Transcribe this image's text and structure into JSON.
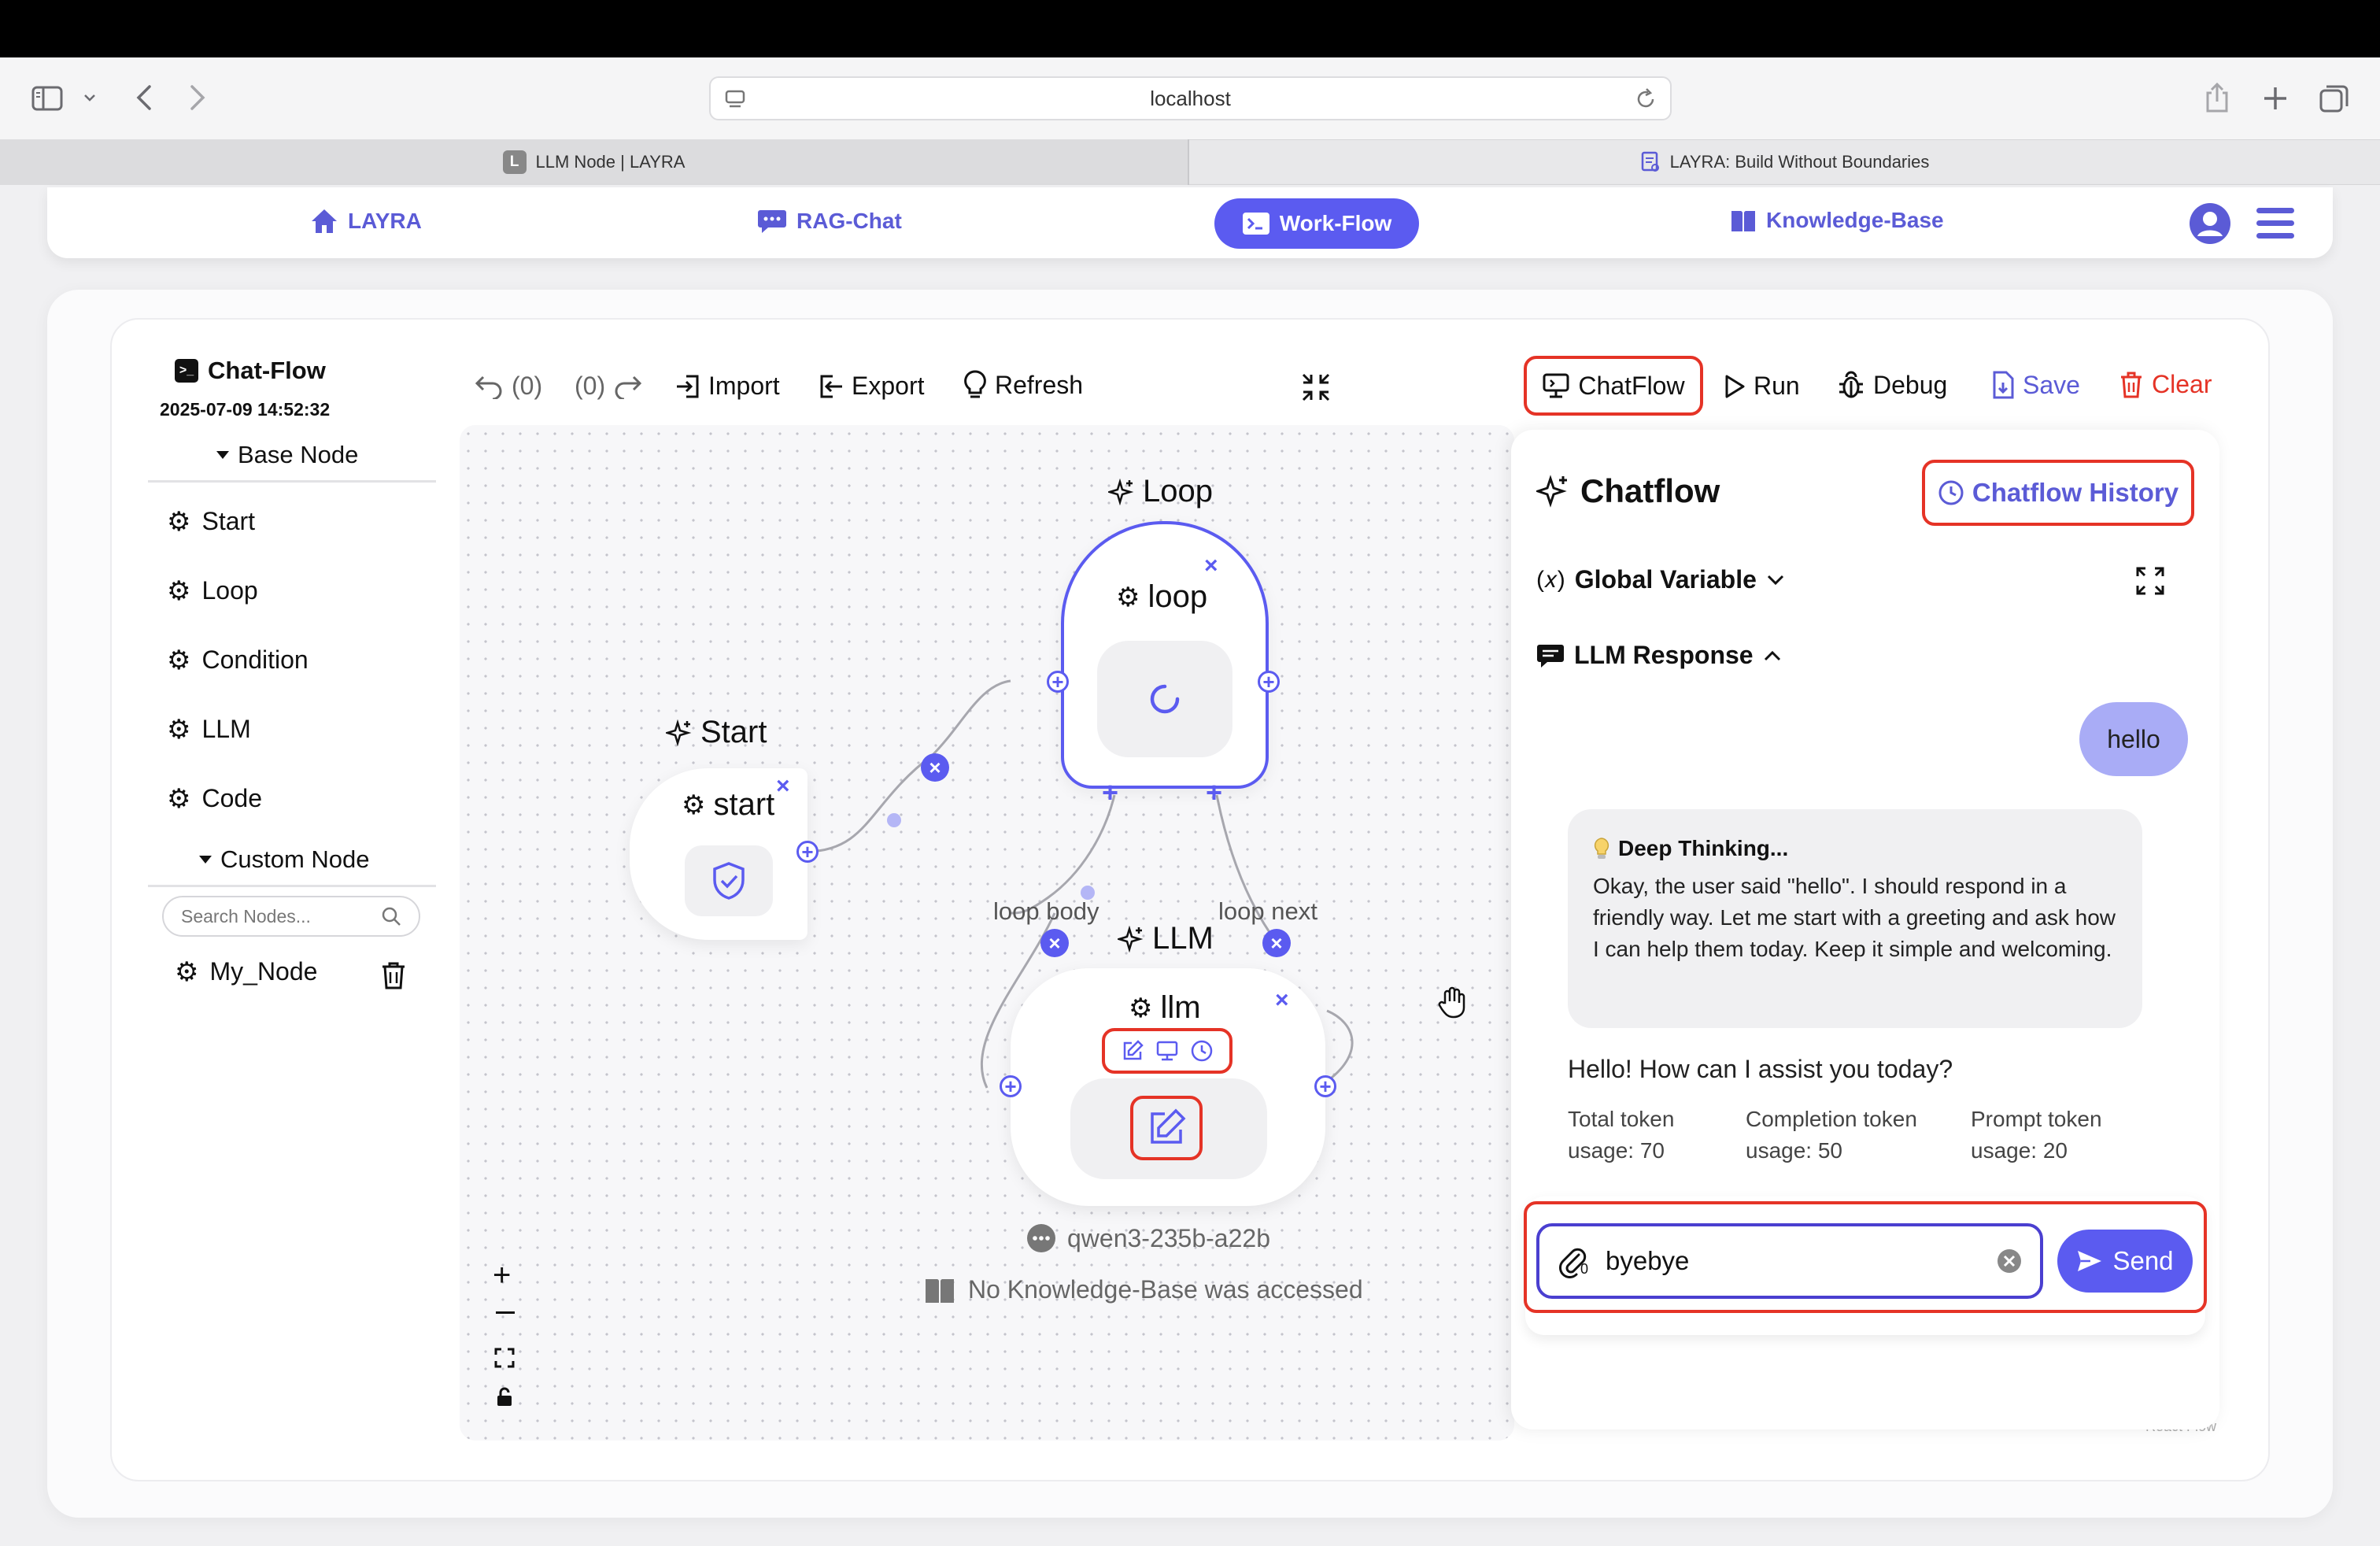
{
  "browser": {
    "url": "localhost",
    "tabs": [
      {
        "favicon": "L",
        "title": "LLM Node | LAYRA"
      },
      {
        "favicon": "doc-icon",
        "title": "LAYRA: Build Without Boundaries"
      }
    ]
  },
  "nav": {
    "home": "LAYRA",
    "rag_chat": "RAG-Chat",
    "workflow": "Work-Flow",
    "knowledge_base": "Knowledge-Base"
  },
  "sidebar": {
    "title": "Chat-Flow",
    "date": "2025-07-09 14:52:32",
    "base_node_header": "Base Node",
    "base_nodes": [
      "Start",
      "Loop",
      "Condition",
      "LLM",
      "Code"
    ],
    "custom_node_header": "Custom Node",
    "search_placeholder": "Search Nodes...",
    "custom_nodes": [
      "My_Node"
    ]
  },
  "toolbar": {
    "undo": "(0)",
    "redo": "(0)",
    "import": "Import",
    "export": "Export",
    "refresh": "Refresh",
    "chatflow": "ChatFlow",
    "run": "Run",
    "debug": "Debug",
    "save": "Save",
    "clear": "Clear"
  },
  "canvas": {
    "start_title": "Start",
    "start_node": "start",
    "loop_title": "Loop",
    "loop_node": "loop",
    "llm_title": "LLM",
    "llm_node": "llm",
    "edge_loop_body": "loop body",
    "edge_loop_next": "loop next",
    "model": "qwen3-235b-a22b",
    "kb_status": "No Knowledge-Base was accessed",
    "watermark": "React Flow"
  },
  "chat": {
    "title": "Chatflow",
    "history_button": "Chatflow History",
    "global_variable": "Global Variable",
    "llm_response": "LLM Response",
    "user_message": "hello",
    "thinking_title": "Deep Thinking...",
    "thinking_text": "Okay, the user said \"hello\". I should respond in a friendly way. Let me start with a greeting and ask how I can help them today. Keep it simple and welcoming.",
    "answer": "Hello! How can I assist you today?",
    "usage": {
      "total_label": "Total token",
      "total_value": "usage: 70",
      "completion_label": "Completion token",
      "completion_value": "usage: 50",
      "prompt_label": "Prompt token",
      "prompt_value": "usage: 20"
    },
    "attachment_count": "0",
    "input_value": "byebye",
    "send": "Send"
  },
  "colors": {
    "accent": "#5b5bf0",
    "accent_text": "#5b5bd6",
    "danger": "#e53326",
    "user_bubble": "#a9acf6"
  }
}
